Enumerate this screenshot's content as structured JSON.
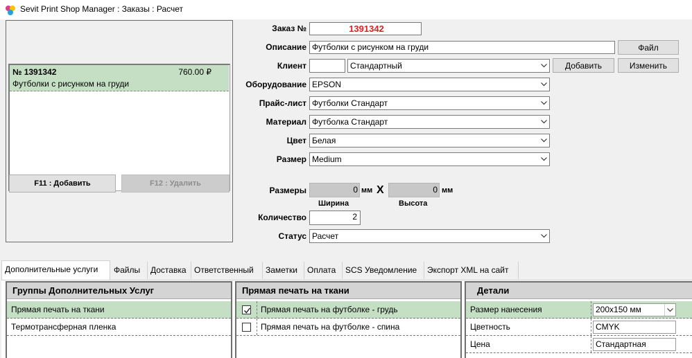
{
  "window": {
    "title": "Sevit Print Shop Manager : Заказы : Расчет"
  },
  "orders": {
    "items": [
      {
        "number": "№ 1391342",
        "price": "760.00 ₽",
        "description": "Футболки с рисунком на груди"
      }
    ],
    "add_button": "F11 : Добавить",
    "delete_button": "F12 : Удалить"
  },
  "form": {
    "order_label": "Заказ №",
    "order_value": "1391342",
    "description_label": "Описание",
    "description_value": "Футболки с рисунком на груди",
    "file_button": "Файл",
    "client_label": "Клиент",
    "client_code": "",
    "client_value": "Стандартный",
    "add_button": "Добавить",
    "edit_button": "Изменить",
    "equipment_label": "Оборудование",
    "equipment_value": "EPSON",
    "pricelist_label": "Прайс-лист",
    "pricelist_value": "Футболки Стандарт",
    "material_label": "Материал",
    "material_value": "Футболка Стандарт",
    "color_label": "Цвет",
    "color_value": "Белая",
    "size_label": "Размер",
    "size_value": "Medium",
    "dimensions_label": "Размеры",
    "width_value": "0",
    "width_unit": "мм",
    "x_sign": "X",
    "height_value": "0",
    "height_unit": "мм",
    "width_caption": "Ширина",
    "height_caption": "Высота",
    "quantity_label": "Количество",
    "quantity_value": "2",
    "status_label": "Статус",
    "status_value": "Расчет"
  },
  "tabs": [
    "Дополнительные услуги",
    "Файлы",
    "Доставка",
    "Ответственный",
    "Заметки",
    "Оплата",
    "SCS Уведомление",
    "Экспорт XML на сайт"
  ],
  "groups": {
    "header": "Группы Дополнительных Услуг",
    "items": [
      "Прямая печать на ткани",
      "Термотрансферная пленка"
    ]
  },
  "services": {
    "header": "Прямая печать на ткани",
    "items": [
      {
        "label": "Прямая печать на футболке - грудь",
        "checked": true
      },
      {
        "label": "Прямая печать на футболке - спина",
        "checked": false
      }
    ]
  },
  "details": {
    "header": "Детали",
    "rows": [
      {
        "label": "Размер нанесения",
        "value": "200x150 мм"
      },
      {
        "label": "Цветность",
        "value": "CMYK"
      },
      {
        "label": "Цена",
        "value": "Стандартная"
      }
    ]
  },
  "colors": {
    "selection": "#c4dfc4",
    "order_number": "#e02020"
  }
}
